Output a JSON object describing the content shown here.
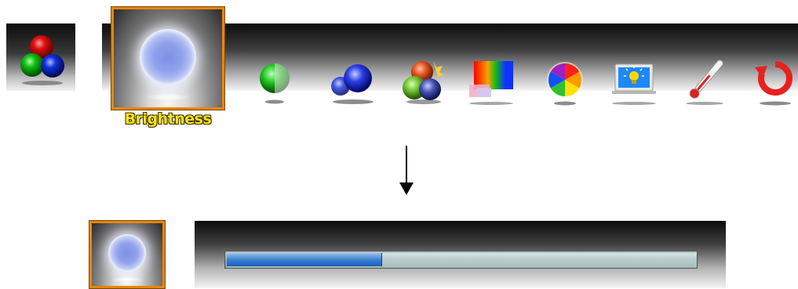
{
  "app": {
    "icon": "rgb-spheres-icon"
  },
  "menu": {
    "selected_label": "Brightness",
    "selected_icon": "brightness-orb-icon",
    "items": [
      {
        "icon": "green-half-sphere-icon"
      },
      {
        "icon": "blue-spheres-icon"
      },
      {
        "icon": "color-blend-spheres-icon"
      },
      {
        "icon": "color-bars-icon"
      },
      {
        "icon": "color-wheel-icon"
      },
      {
        "icon": "monitor-lightbulb-icon"
      },
      {
        "icon": "thermometer-icon"
      },
      {
        "icon": "reset-arrow-icon"
      }
    ]
  },
  "slider": {
    "value_fraction": 0.33,
    "fill_color": "#1d5db8",
    "track_color": "#b9cccc"
  },
  "colors": {
    "accent": "#e8850c",
    "label": "#f6e31a"
  }
}
